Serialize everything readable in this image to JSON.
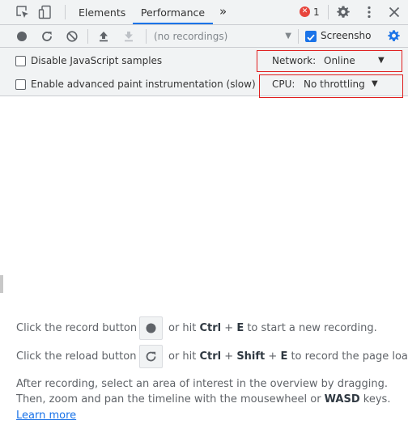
{
  "tabs": {
    "elements": "Elements",
    "performance": "Performance",
    "more": "»"
  },
  "errors": {
    "count": "1"
  },
  "toolbar": {
    "recordings_placeholder": "(no recordings)",
    "screenshots_label": "Screenshots",
    "screenshots_checked": true
  },
  "settings": {
    "disable_js_samples": "Disable JavaScript samples",
    "enable_paint": "Enable advanced paint instrumentation (slow)",
    "network_label": "Network:",
    "network_value": "Online",
    "cpu_label": "CPU:",
    "cpu_value": "No throttling"
  },
  "instructions": {
    "record_prefix": "Click the record button",
    "record_suffix_1": "or hit ",
    "record_key_1": "Ctrl",
    "record_plus": " + ",
    "record_key_2": "E",
    "record_suffix_2": " to start a new recording.",
    "reload_prefix": "Click the reload button",
    "reload_suffix_1": "or hit ",
    "reload_key_1": "Ctrl",
    "reload_plus_1": " + ",
    "reload_key_2": "Shift",
    "reload_plus_2": " + ",
    "reload_key_3": "E",
    "reload_suffix_2": " to record the page load.",
    "after_line_1": "After recording, select an area of interest in the overview by dragging.",
    "after_line_2_prefix": "Then, zoom and pan the timeline with the mousewheel or ",
    "after_line_2_key": "WASD",
    "after_line_2_suffix": " keys.",
    "learn_more": "Learn more"
  },
  "colors": {
    "accent": "#1a73e8",
    "error": "#e8453c",
    "highlight_border": "#e01e1e"
  },
  "icons": {
    "inspect": "inspect-element-icon",
    "device": "device-toolbar-icon",
    "error": "error-icon",
    "settings": "gear-icon",
    "menu": "kebab-menu-icon",
    "close": "close-icon",
    "record": "record-icon",
    "reload": "reload-icon",
    "clear": "clear-icon",
    "upload": "upload-icon",
    "download": "download-icon",
    "capture_settings": "capture-settings-gear-icon"
  }
}
